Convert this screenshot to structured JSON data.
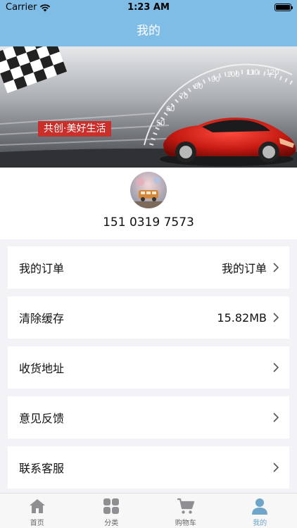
{
  "status_bar": {
    "carrier": "Carrier",
    "time": "1:23 AM"
  },
  "nav": {
    "title": "我的"
  },
  "banner": {
    "slogan": "共创·美好生活"
  },
  "profile": {
    "phone": "151 0319 7573"
  },
  "menu": [
    {
      "label": "我的订单",
      "value": "我的订单"
    },
    {
      "label": "清除缓存",
      "value": "15.82MB"
    },
    {
      "label": "收货地址",
      "value": ""
    },
    {
      "label": "意见反馈",
      "value": ""
    },
    {
      "label": "联系客服",
      "value": ""
    }
  ],
  "tabs": [
    {
      "label": "首页",
      "icon": "home-icon"
    },
    {
      "label": "分类",
      "icon": "category-icon"
    },
    {
      "label": "购物车",
      "icon": "cart-icon"
    },
    {
      "label": "我的",
      "icon": "profile-icon",
      "active": true
    }
  ],
  "colors": {
    "nav": "#7fbde6",
    "tab_inactive": "#8e8e93",
    "tab_active": "#6fa5c8",
    "slogan_bg": "#c9302c"
  }
}
